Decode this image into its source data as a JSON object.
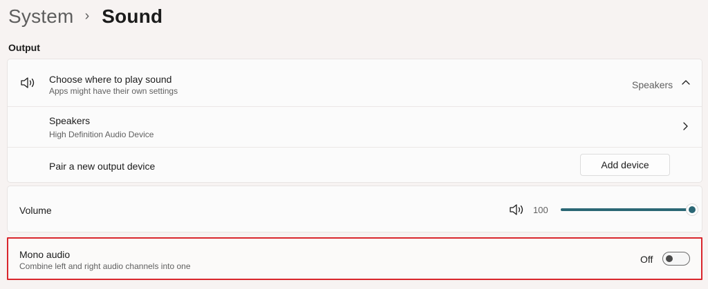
{
  "breadcrumb": {
    "parent": "System",
    "separator": "›",
    "current": "Sound"
  },
  "output": {
    "section_label": "Output",
    "choose": {
      "title": "Choose where to play sound",
      "subtitle": "Apps might have their own settings",
      "selected_value": "Speakers",
      "icon": "speaker-icon",
      "expand_icon": "chevron-up-icon"
    },
    "speakers": {
      "title": "Speakers",
      "subtitle": "High Definition Audio Device",
      "nav_icon": "chevron-right-icon"
    },
    "pair": {
      "title": "Pair a new output device",
      "button_label": "Add device"
    }
  },
  "volume": {
    "label": "Volume",
    "value_text": "100",
    "level": 1.0,
    "icon": "speaker-icon"
  },
  "mono": {
    "title": "Mono audio",
    "subtitle": "Combine left and right audio channels into one",
    "state_text": "Off",
    "enabled": false
  },
  "colors": {
    "accent": "#2b6775",
    "highlight_border": "#d9252b",
    "background": "#f7f3f2"
  }
}
